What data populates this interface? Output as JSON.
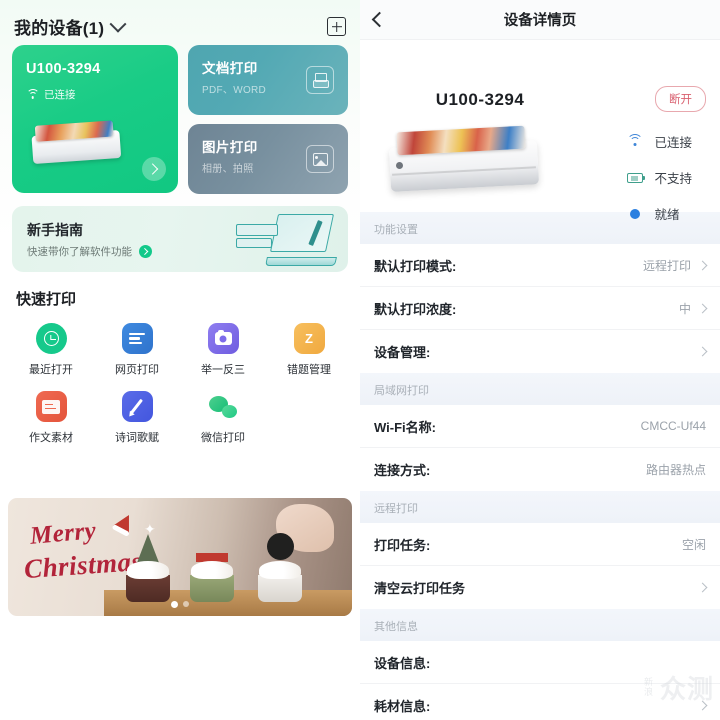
{
  "left": {
    "header": {
      "title": "我的设备(1)",
      "dropdown_icon": "chevron-down-icon",
      "add_icon": "plus-box-icon"
    },
    "device_card": {
      "name": "U100-3294",
      "status": "已连接",
      "status_icon": "wifi-icon",
      "arrow_icon": "chevron-right-icon"
    },
    "function_tiles": [
      {
        "title": "文档打印",
        "subtitle": "PDF、WORD",
        "icon": "document-print-icon"
      },
      {
        "title": "图片打印",
        "subtitle": "相册、拍照",
        "icon": "image-print-icon"
      }
    ],
    "guide": {
      "title": "新手指南",
      "subtitle": "快速带你了解软件功能",
      "go_icon": "arrow-right-circle-icon",
      "art_icon": "laptop-pen-icon"
    },
    "quick_print": {
      "section_title": "快速打印",
      "items": [
        {
          "label": "最近打开",
          "icon": "clock-icon",
          "color": "#16c98b"
        },
        {
          "label": "网页打印",
          "icon": "lines-icon",
          "color": "#3f8ae0"
        },
        {
          "label": "举一反三",
          "icon": "camera-icon",
          "color": "#7d6bea"
        },
        {
          "label": "错题管理",
          "icon": "notebook-icon",
          "color": "#f0a93f"
        },
        {
          "label": "作文素材",
          "icon": "folder-icon",
          "color": "#e4543b"
        },
        {
          "label": "诗词歌赋",
          "icon": "pencil-icon",
          "color": "#4356de"
        },
        {
          "label": "微信打印",
          "icon": "wechat-icon",
          "color": "#1fc984"
        }
      ]
    },
    "banner": {
      "line1": "Merry",
      "line2": "Christmas",
      "icon": "santa-hat-icon",
      "dots": 2,
      "active_dot": 0
    }
  },
  "right": {
    "header": {
      "back_icon": "chevron-left-icon",
      "title": "设备详情页"
    },
    "hero": {
      "device_name": "U100-3294",
      "disconnect_label": "断开",
      "printer_icon": "printer-image",
      "stats": [
        {
          "label": "已连接",
          "icon": "wifi-icon",
          "color": "#3f86d8"
        },
        {
          "label": "不支持",
          "icon": "battery-icon",
          "color": "#3f9f8c"
        },
        {
          "label": "就绪",
          "icon": "status-dot-icon",
          "color": "#2a7fe0"
        }
      ]
    },
    "sections": [
      {
        "title": "功能设置",
        "rows": [
          {
            "label": "默认打印模式:",
            "value": "远程打印",
            "chevron": true
          },
          {
            "label": "默认打印浓度:",
            "value": "中",
            "chevron": true
          },
          {
            "label": "设备管理:",
            "value": "",
            "chevron": true
          }
        ]
      },
      {
        "title": "局域网打印",
        "rows": [
          {
            "label": "Wi-Fi名称:",
            "value": "CMCC-Uf44",
            "chevron": false
          },
          {
            "label": "连接方式:",
            "value": "路由器热点",
            "chevron": false
          }
        ]
      },
      {
        "title": "远程打印",
        "rows": [
          {
            "label": "打印任务:",
            "value": "空闲",
            "chevron": false
          },
          {
            "label": "清空云打印任务",
            "value": "",
            "chevron": true
          }
        ]
      },
      {
        "title": "其他信息",
        "rows": [
          {
            "label": "设备信息:",
            "value": "",
            "chevron": false
          },
          {
            "label": "耗材信息:",
            "value": "",
            "chevron": true
          }
        ]
      }
    ],
    "watermark": {
      "small": "新浪",
      "big": "众测"
    }
  }
}
